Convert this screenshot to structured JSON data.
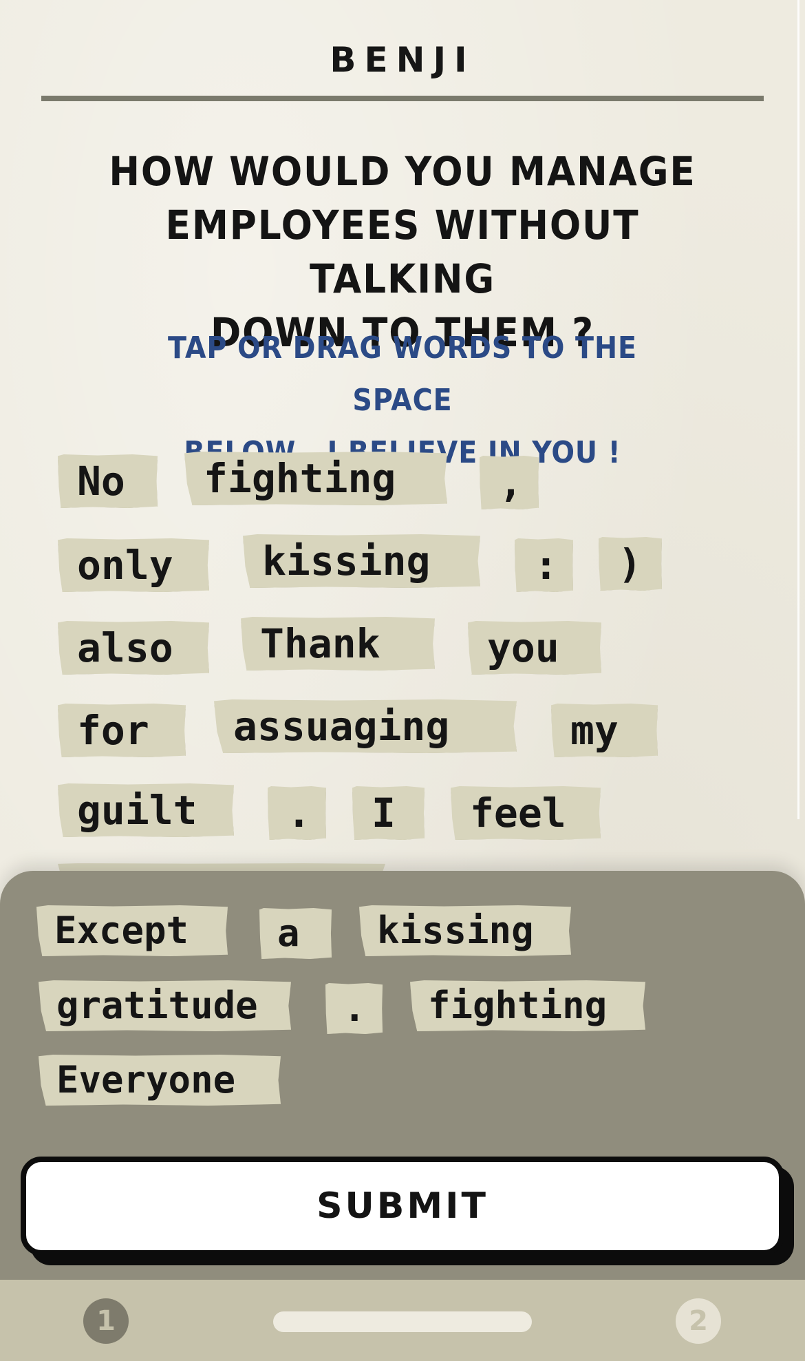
{
  "header": {
    "player_name": "BENJI"
  },
  "prompt": {
    "question_lines": [
      "HOW WOULD YOU MANAGE",
      "EMPLOYEES WITHOUT TALKING",
      "DOWN TO THEM ?"
    ],
    "instruction_lines": [
      "TAP OR DRAG WORDS TO THE SPACE",
      "BELOW . I BELIEVE IN YOU !"
    ]
  },
  "answer_words": [
    "No",
    "fighting",
    ",",
    "only",
    "kissing",
    ":",
    ")",
    "also",
    "Thank",
    "you",
    "for",
    "assuaging",
    "my",
    "guilt",
    ".",
    "I",
    "feel",
    ""
  ],
  "word_bank": [
    "Except",
    "a",
    "kissing",
    "gratitude",
    ".",
    "fighting",
    "Everyone"
  ],
  "actions": {
    "submit_label": "SUBMIT"
  },
  "progress": {
    "steps": [
      "1",
      "2"
    ],
    "current_step": 1
  },
  "colors": {
    "background": "#eeebe0",
    "tile": "#d8d5bd",
    "bank": "#908d7d",
    "instruction": "#2b4a86",
    "bottom_bar": "#c6c2ab"
  }
}
